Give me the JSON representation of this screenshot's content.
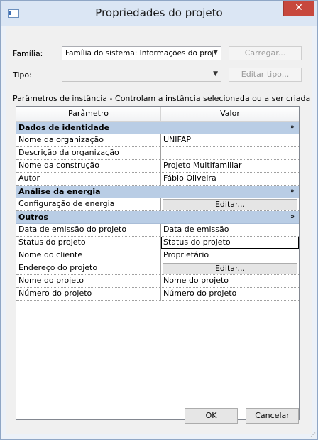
{
  "window": {
    "title": "Propriedades do projeto",
    "close_glyph": "✕"
  },
  "family": {
    "label": "Família:",
    "value": "Família do sistema: Informações do projet",
    "load_button": "Carregar..."
  },
  "type": {
    "label": "Tipo:",
    "value": "",
    "edit_type_button": "Editar tipo..."
  },
  "instance_caption": "Parâmetros de instância - Controlam a instância selecionada ou a ser criada",
  "grid": {
    "col_param": "Parâmetro",
    "col_value": "Valor",
    "groups": [
      {
        "title": "Dados de identidade",
        "chevron": "»",
        "rows": [
          {
            "param": "Nome da organização",
            "value": "UNIFAP"
          },
          {
            "param": "Descrição da organização",
            "value": ""
          },
          {
            "param": "Nome da construção",
            "value": "Projeto Multifamiliar"
          },
          {
            "param": "Autor",
            "value": "Fábio Oliveira"
          }
        ]
      },
      {
        "title": "Análise da energia",
        "chevron": "»",
        "rows": [
          {
            "param": "Configuração de energia",
            "button": "Editar..."
          }
        ]
      },
      {
        "title": "Outros",
        "chevron": "»",
        "rows": [
          {
            "param": "Data de emissão do projeto",
            "value": "Data de emissão"
          },
          {
            "param": "Status do projeto",
            "value": "Status do projeto"
          },
          {
            "param": "Nome do cliente",
            "value": "Proprietário"
          },
          {
            "param": "Endereço do projeto",
            "button": "Editar..."
          },
          {
            "param": "Nome do projeto",
            "value": "Nome do projeto"
          },
          {
            "param": "Número do projeto",
            "value": "Número do projeto"
          }
        ]
      }
    ]
  },
  "footer": {
    "ok_label": "OK",
    "cancel_label": "Cancelar"
  }
}
